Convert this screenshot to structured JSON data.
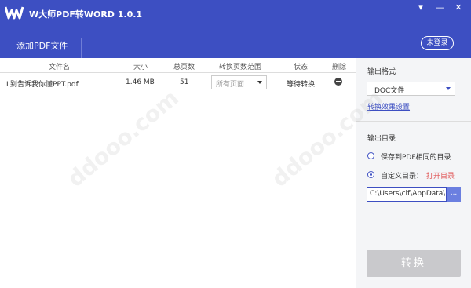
{
  "app": {
    "title": "W大师PDF转WORD 1.0.1"
  },
  "window_controls": {
    "menu": "▾",
    "minimize": "—",
    "close": "✕"
  },
  "toolbar": {
    "add_pdf": "添加PDF文件",
    "login": "未登录"
  },
  "table": {
    "headers": [
      "文件名",
      "大小",
      "总页数",
      "转换页数范围",
      "状态",
      "删除"
    ],
    "rows": [
      {
        "filename": "L别告诉我你懂PPT.pdf",
        "size": "1.46 MB",
        "pages": "51",
        "range": "所有页面",
        "status": "等待转换"
      }
    ]
  },
  "sidebar": {
    "output_format_label": "输出格式",
    "format_value": "DOC文件",
    "settings_link": "转换效果设置",
    "output_dir_label": "输出目录",
    "option_same": "保存到PDF相同的目录",
    "option_custom": "自定义目录：",
    "open_dir": "打开目录",
    "path_value": "C:\\Users\\clf\\AppData\\F",
    "browse": "...",
    "convert": "转换"
  },
  "watermark": "ddooo.com",
  "colors": {
    "accent": "#3d4fc2",
    "button_disabled": "#c9c9cc",
    "link_red": "#e05454"
  }
}
